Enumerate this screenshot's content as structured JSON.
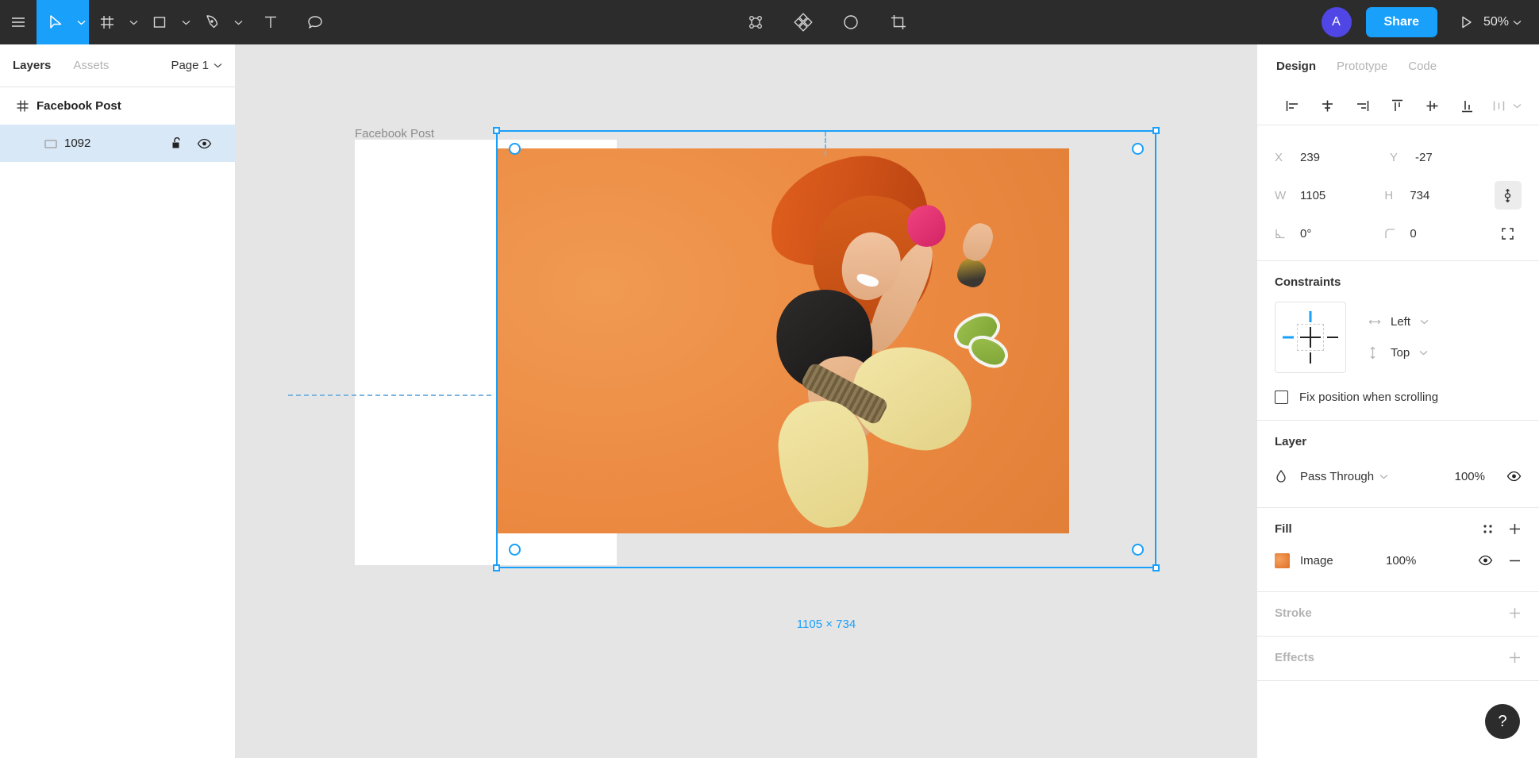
{
  "toolbar": {
    "menu_icon": "hamburger-menu-icon",
    "tools": [
      {
        "name": "move-tool",
        "icon": "cursor-arrow-icon",
        "active": true,
        "caret": true
      },
      {
        "name": "frame-tool",
        "icon": "frame-grid-icon",
        "active": false,
        "caret": true
      },
      {
        "name": "shape-tool",
        "icon": "rectangle-icon",
        "active": false,
        "caret": true
      },
      {
        "name": "pen-tool",
        "icon": "pen-nib-icon",
        "active": false,
        "caret": true
      },
      {
        "name": "text-tool",
        "icon": "text-t-icon",
        "active": false,
        "caret": false
      },
      {
        "name": "comment-tool",
        "icon": "comment-bubble-icon",
        "active": false,
        "caret": false
      }
    ],
    "center_tools": [
      {
        "name": "component-tool",
        "icon": "component-nodes-icon"
      },
      {
        "name": "plugins-tool",
        "icon": "diamond-cluster-icon"
      },
      {
        "name": "mask-tool",
        "icon": "half-circle-mask-icon"
      },
      {
        "name": "crop-tool",
        "icon": "crop-icon"
      }
    ],
    "avatar_initial": "A",
    "share_label": "Share",
    "present_icon": "play-triangle-icon",
    "zoom_level": "50%"
  },
  "left_panel": {
    "tabs": [
      {
        "label": "Layers",
        "active": true
      },
      {
        "label": "Assets",
        "active": false
      }
    ],
    "page_selector": "Page 1",
    "layers": [
      {
        "name": "Facebook Post",
        "icon": "frame-hash-icon",
        "selected": false,
        "bold": true
      },
      {
        "name": "1092",
        "icon": "image-rect-icon",
        "selected": true,
        "bold": false,
        "actions": [
          "unlock-icon",
          "eye-visible-icon"
        ]
      }
    ]
  },
  "canvas": {
    "frame_label": "Facebook Post",
    "selection_dimensions": "1105 × 734"
  },
  "right_panel": {
    "tabs": [
      {
        "label": "Design",
        "active": true
      },
      {
        "label": "Prototype",
        "active": false
      },
      {
        "label": "Code",
        "active": false
      }
    ],
    "align_tools": [
      "align-left-icon",
      "align-horizontal-center-icon",
      "align-right-icon",
      "align-top-icon",
      "align-vertical-center-icon",
      "align-bottom-icon",
      "distribute-icon"
    ],
    "transform": {
      "x_label": "X",
      "x_value": "239",
      "y_label": "Y",
      "y_value": "-27",
      "w_label": "W",
      "w_value": "1105",
      "h_label": "H",
      "h_value": "734",
      "rotation_label": "rotation-icon",
      "rotation_value": "0°",
      "corner_label": "corner-radius-icon",
      "corner_value": "0",
      "ratio_lock_icon": "link-constrain-proportions-icon",
      "independent_corners_icon": "independent-corners-icon"
    },
    "constraints": {
      "title": "Constraints",
      "horizontal": "Left",
      "vertical": "Top",
      "fix_position_label": "Fix position when scrolling",
      "fix_position_checked": false,
      "active_color": "#18a0fb"
    },
    "layer": {
      "title": "Layer",
      "blend_mode": "Pass Through",
      "opacity": "100%",
      "blend_icon": "blend-drop-icon",
      "visibility_icon": "eye-visible-icon"
    },
    "fill": {
      "title": "Fill",
      "items": [
        {
          "type": "Image",
          "opacity": "100%",
          "swatch": "image-thumbnail",
          "visibility_icon": "eye-visible-icon",
          "remove_icon": "minus-icon"
        }
      ],
      "style_icon": "fill-styles-icon",
      "add_icon": "plus-icon"
    },
    "stroke": {
      "title": "Stroke",
      "add_icon": "plus-icon"
    },
    "effects": {
      "title": "Effects",
      "add_icon": "plus-icon"
    },
    "help_label": "?"
  }
}
